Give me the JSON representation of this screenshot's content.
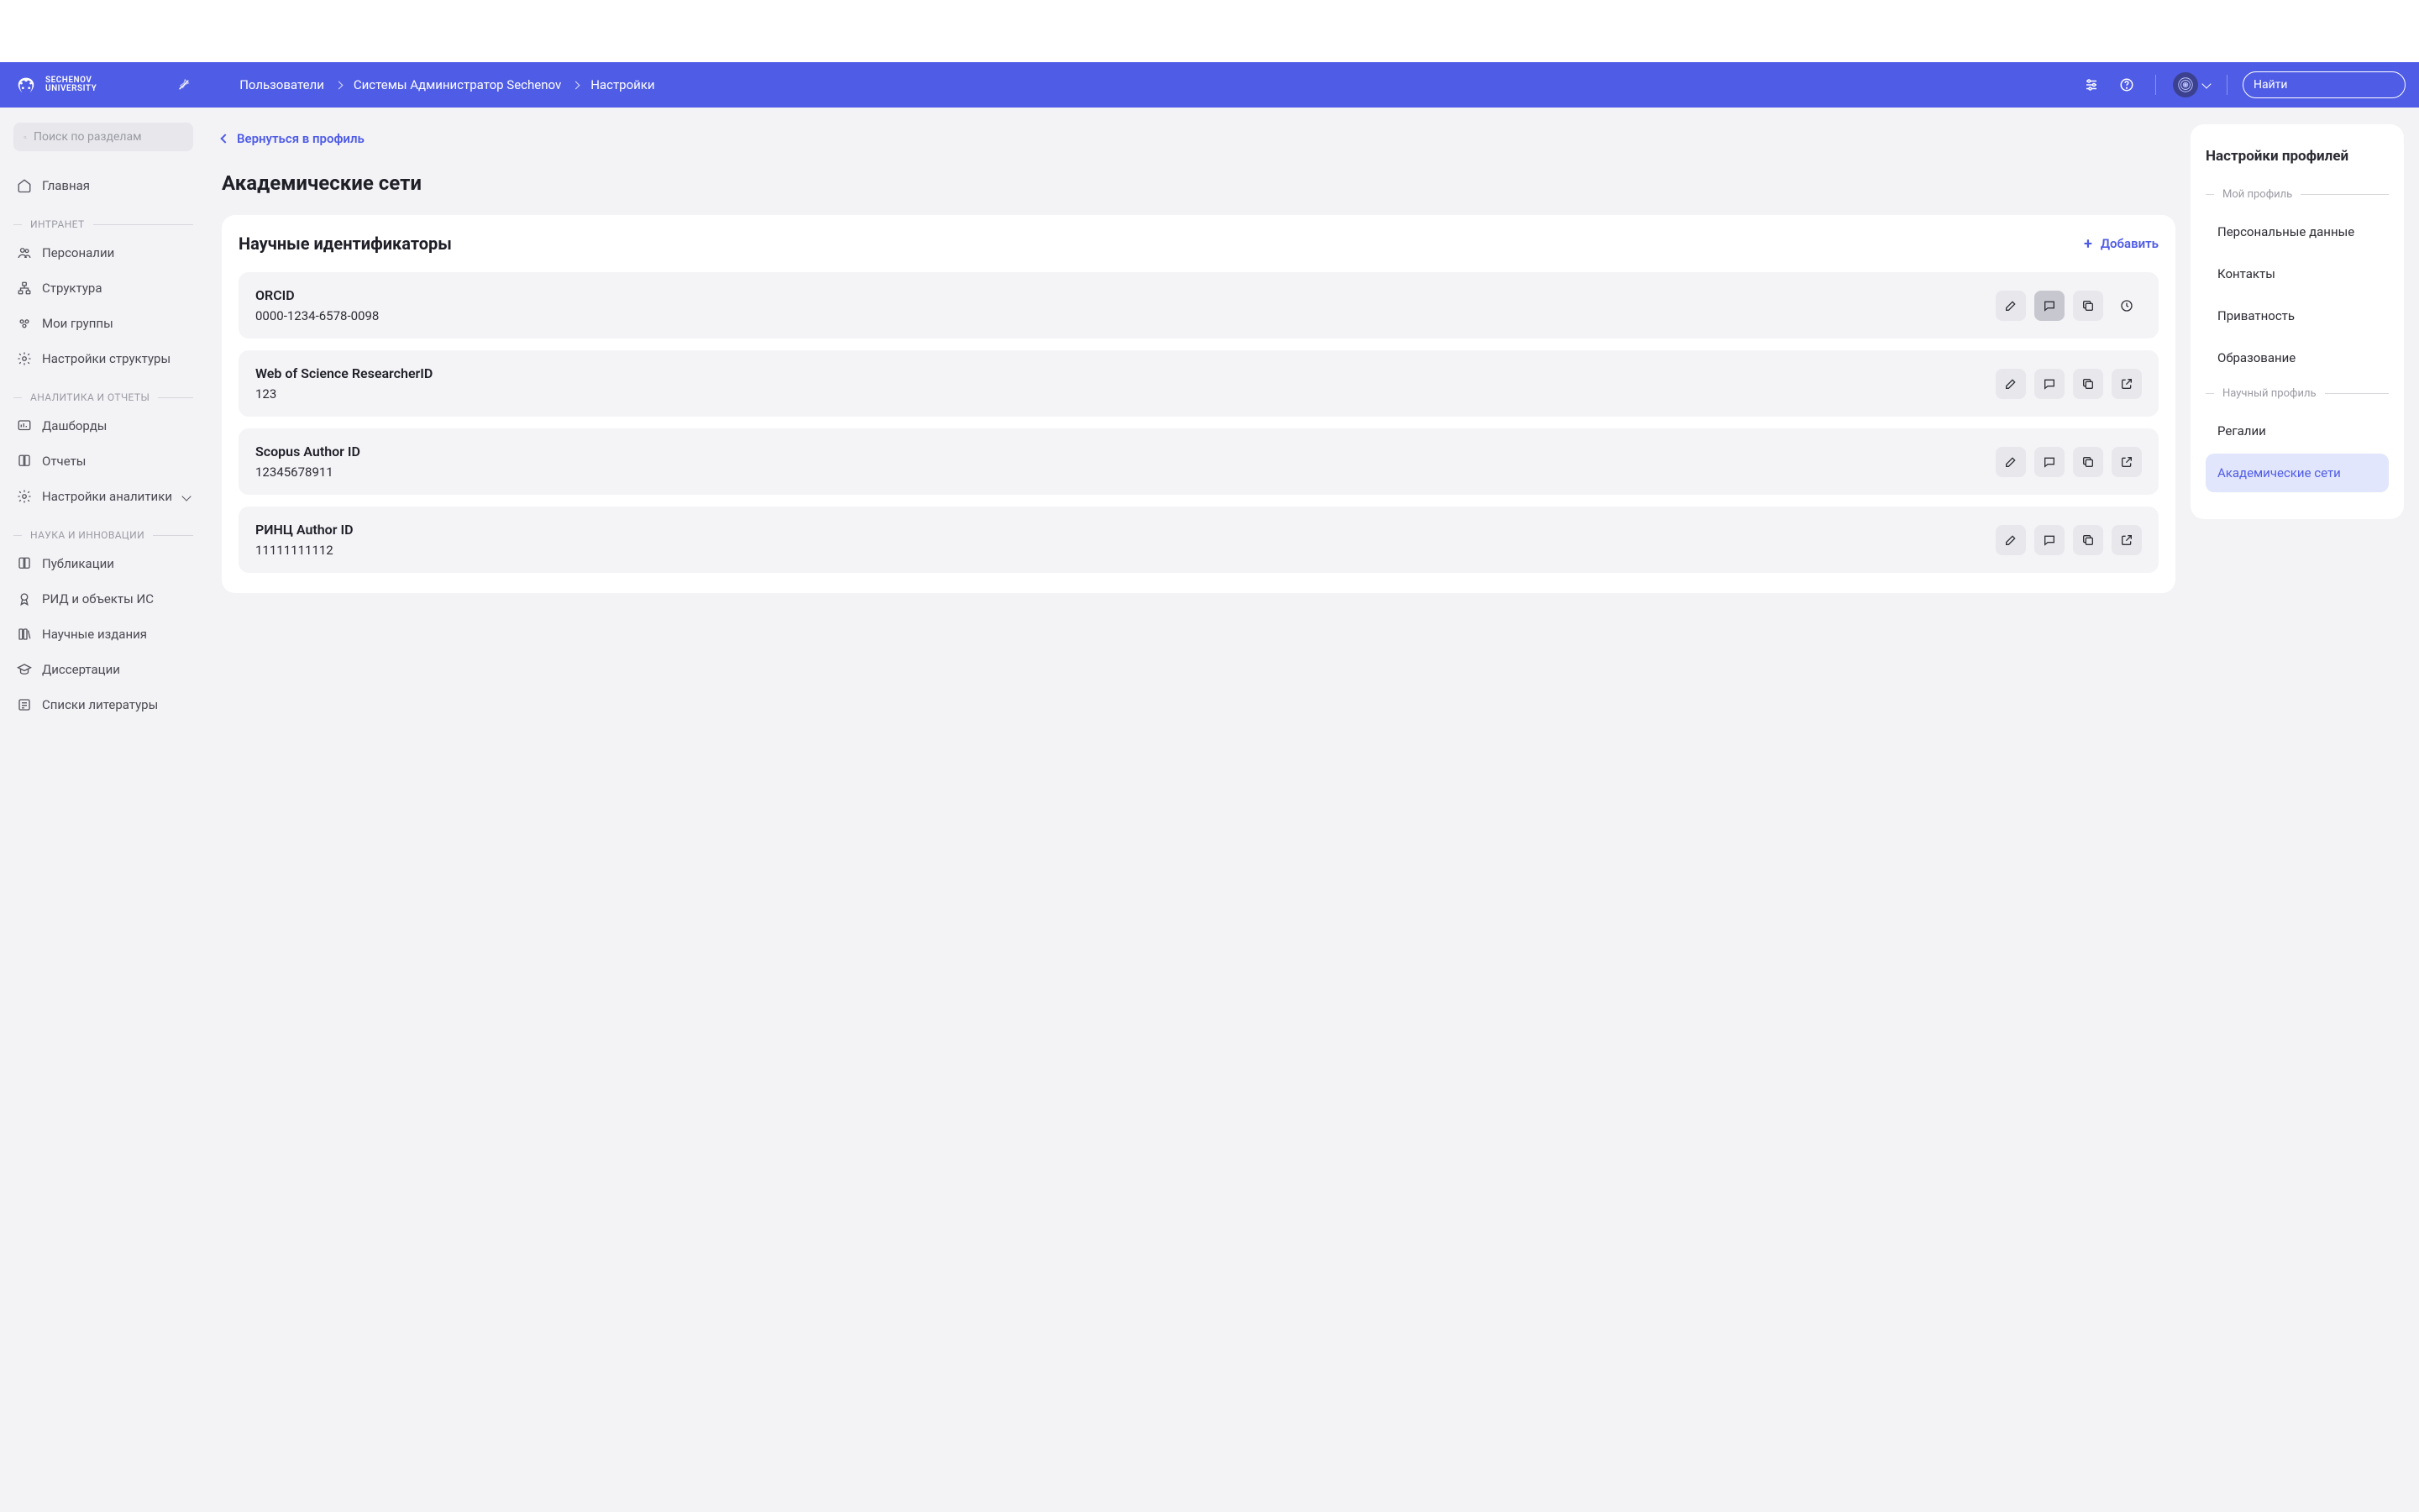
{
  "brand": {
    "line1": "SECHENOV",
    "line2": "UNIVERSITY"
  },
  "breadcrumbs": [
    "Пользователи",
    "Системы Администратор Sechenov",
    "Настройки"
  ],
  "header_search_placeholder": "Найти",
  "sidebar": {
    "search_placeholder": "Поиск по разделам",
    "main": "Главная",
    "groups": [
      {
        "title": "ИНТРАНЕТ",
        "items": [
          "Персоналии",
          "Структура",
          "Мои группы",
          "Настройки структуры"
        ]
      },
      {
        "title": "АНАЛИТИКА И ОТЧЕТЫ",
        "items": [
          "Дашборды",
          "Отчеты",
          "Настройки аналитики"
        ]
      },
      {
        "title": "НАУКА И ИННОВАЦИИ",
        "items": [
          "Публикации",
          "РИД и объекты ИС",
          "Научные издания",
          "Диссертации",
          "Списки литературы"
        ]
      }
    ]
  },
  "back_label": "Вернуться в профиль",
  "page_title": "Академические сети",
  "card_title": "Научные идентификаторы",
  "add_label": "Добавить",
  "identifiers": [
    {
      "name": "ORCID",
      "value": "0000-1234-6578-0098",
      "has_link": false,
      "has_history": true
    },
    {
      "name": "Web of Science ResearcherID",
      "value": "123",
      "has_link": true,
      "has_history": false
    },
    {
      "name": "Scopus Author ID",
      "value": "12345678911",
      "has_link": true,
      "has_history": false
    },
    {
      "name": "РИНЦ Author ID",
      "value": "11111111112",
      "has_link": true,
      "has_history": false
    }
  ],
  "right": {
    "title": "Настройки профилей",
    "groups": [
      {
        "title": "Мой профиль",
        "items": [
          {
            "label": "Персональные данные",
            "active": false
          },
          {
            "label": "Контакты",
            "active": false
          },
          {
            "label": "Приватность",
            "active": false
          },
          {
            "label": "Образование",
            "active": false
          }
        ]
      },
      {
        "title": "Научный профиль",
        "items": [
          {
            "label": "Регалии",
            "active": false
          },
          {
            "label": "Академические сети",
            "active": true
          }
        ]
      }
    ]
  }
}
